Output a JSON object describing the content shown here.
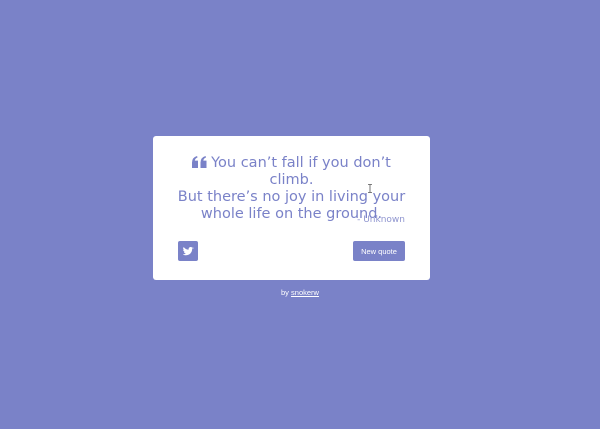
{
  "quote": {
    "line1": "You can’t fall if you don’t climb.",
    "line2": "But there’s no joy in living your",
    "line3": "whole life on the ground.",
    "author": "- Unknown",
    "icon": "quote-left-icon"
  },
  "actions": {
    "tweet_icon": "twitter-icon",
    "new_quote_label": "New quote"
  },
  "footer": {
    "prefix": "by",
    "author_link": "snokerw"
  },
  "colors": {
    "background": "#7a82c8",
    "card": "#ffffff",
    "accent": "#7a82c8"
  }
}
